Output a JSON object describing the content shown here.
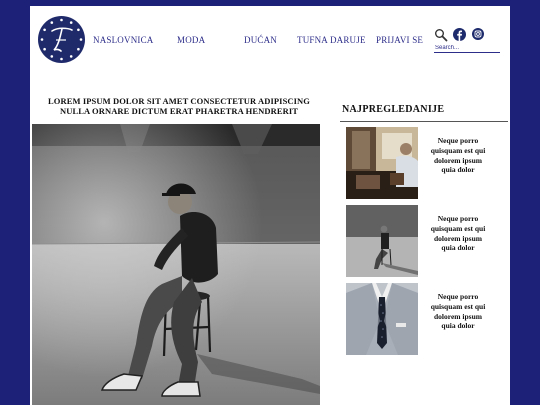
{
  "header": {
    "nav": [
      "NASLOVNICA",
      "MODA",
      "DUĆAN",
      "TUFNA DARUJE",
      "PRIJAVI SE"
    ],
    "search": {
      "placeholder": "Search..."
    },
    "icons": [
      "search-icon",
      "facebook-icon",
      "instagram-icon"
    ],
    "logo_letter": "T"
  },
  "article": {
    "title_line1": "LOREM IPSUM DOLOR SIT AMET CONSECTETUR ADIPISCING",
    "title_line2": "NULLA ORNARE DICTUM ERAT PHARETRA HENDRERIT"
  },
  "sidebar": {
    "title": "NAJPREGLEDANIJE",
    "posts": [
      {
        "text": "Neque porro quisquam est qui dolorem ipsum quia dolor"
      },
      {
        "text": "Neque porro quisquam est qui dolorem ipsum quia dolor"
      },
      {
        "text": "Neque porro quisquam est qui dolorem ipsum quia dolor"
      }
    ]
  },
  "colors": {
    "background": "#1d2178",
    "nav_text": "#2d2d8a",
    "logo": "#1f2a6b"
  }
}
